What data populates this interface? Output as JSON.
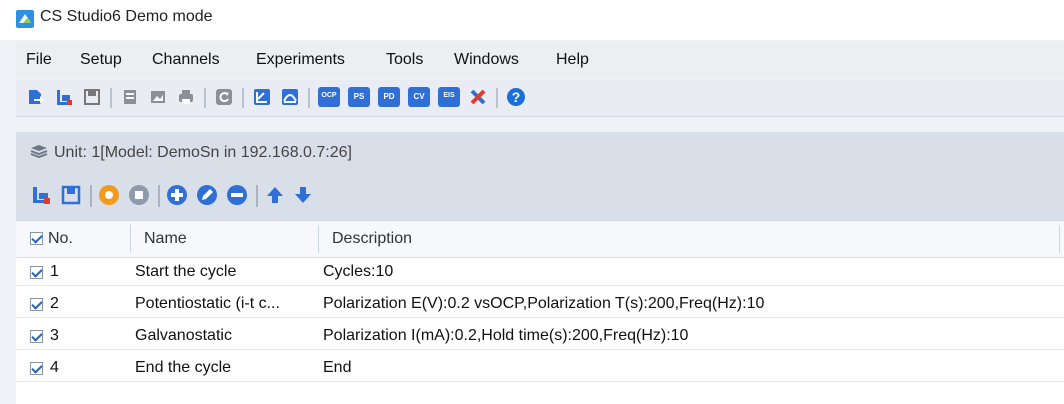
{
  "window": {
    "title": "CS Studio6  Demo mode",
    "icon": "app-logo-icon"
  },
  "menubar": {
    "items": [
      "File",
      "Setup",
      "Channels",
      "Experiments",
      "Tools",
      "Windows",
      "Help"
    ]
  },
  "toolbar": {
    "icons": [
      "open-file-icon",
      "new-experiment-icon",
      "save-icon",
      "copy-icon",
      "export-image-icon",
      "print-icon",
      "refresh-icon",
      "measure-icon",
      "overlay-icon",
      "ocp-icon",
      "ps-icon",
      "pd-icon",
      "cv-icon",
      "eis-icon",
      "settings-tools-icon",
      "help-icon"
    ],
    "labels": {
      "ocp": "OCP",
      "ps": "PS",
      "pd": "PD",
      "cv": "CV",
      "eis": "EIS"
    }
  },
  "unit": {
    "label": "Unit: 1[Model:  DemoSn in 192.168.0.7:26]",
    "icon": "stack-layers-icon"
  },
  "experiment_toolbar": {
    "icons": [
      "new-experiment-icon",
      "save-icon",
      "run-icon",
      "stop-icon",
      "add-step-icon",
      "edit-step-icon",
      "remove-step-icon",
      "move-up-icon",
      "move-down-icon"
    ]
  },
  "table": {
    "columns": [
      "No.",
      "Name",
      "Description"
    ],
    "rows": [
      {
        "checked": true,
        "no": "1",
        "name": "Start the cycle",
        "description": "Cycles:10"
      },
      {
        "checked": true,
        "no": "2",
        "name": "Potentiostatic (i-t c...",
        "description": "Polarization E(V):0.2 vsOCP,Polarization T(s):200,Freq(Hz):10"
      },
      {
        "checked": true,
        "no": "3",
        "name": "Galvanostatic",
        "description": "Polarization I(mA):0.2,Hold time(s):200,Freq(Hz):10"
      },
      {
        "checked": true,
        "no": "4",
        "name": "End the cycle",
        "description": "End"
      }
    ]
  },
  "colors": {
    "accent_blue": "#2f6fd6",
    "run_orange": "#f39a1e",
    "stop_gray": "#8e9aaa",
    "help_blue": "#1d6fd8"
  }
}
